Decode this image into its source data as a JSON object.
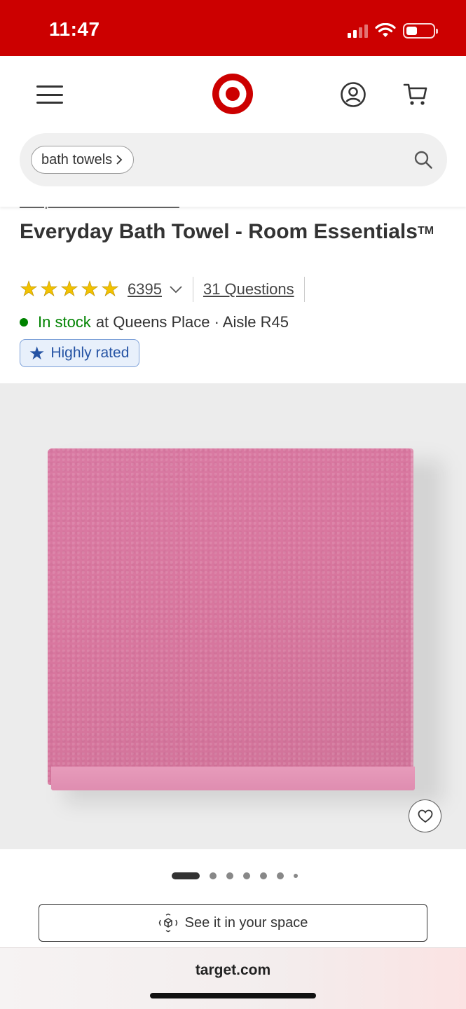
{
  "status_bar": {
    "time": "11:47",
    "battery_level": 0.4,
    "signal_bars": 2,
    "icons": [
      "signal-icon",
      "wifi-icon",
      "battery-icon"
    ]
  },
  "header": {
    "menu_icon": "hamburger-menu-icon",
    "logo": "target-bullseye-logo",
    "account_icon": "account-icon",
    "cart_icon": "cart-icon",
    "brand_color": "#cc0000"
  },
  "search": {
    "chip_label": "bath towels",
    "chip_icon": "chevron-right-icon",
    "icon": "search-icon"
  },
  "product": {
    "breadcrumb_link": "Shop all Room Essentials",
    "title": "Everyday Bath Towel - Room Essentials",
    "trademark": "TM",
    "rating": 5,
    "review_count": "6395",
    "questions_link": "31 Questions",
    "stock_status": "In stock",
    "stock_location": "at Queens Place · Aisle R45",
    "badge_label": "Highly rated",
    "stock_color": "#008300",
    "badge_color": "#2553a4"
  },
  "gallery": {
    "image_description_icon": "towel-image",
    "favorite_icon": "heart-icon",
    "total_images": 7,
    "active_index": 0
  },
  "ar_button": {
    "label": "See it in your space",
    "icon": "ar-cube-icon"
  },
  "browser": {
    "url": "target.com"
  }
}
